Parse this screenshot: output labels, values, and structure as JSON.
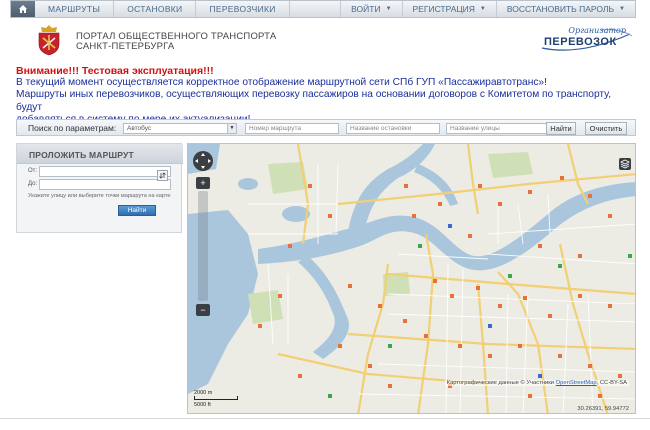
{
  "nav": {
    "items": [
      "Маршруты",
      "Остановки",
      "Перевозчики"
    ],
    "right": [
      {
        "label": "Войти"
      },
      {
        "label": "Регистрация"
      },
      {
        "label": "Восстановить пароль"
      }
    ],
    "home_icon": "home-icon"
  },
  "header": {
    "title_line1": "ПОРТАЛ ОБЩЕСТВЕННОГО ТРАНСПОРТА",
    "title_line2": "САНКТ-ПЕТЕРБУРГА",
    "org_top": "Организатор",
    "org_main": "ПЕРЕВОЗОК"
  },
  "notice": {
    "warning": "Внимание!!! Тестовая эксплуатация!!!",
    "line1": "В текущий момент осуществляется корректное отображение маршрутной сети СПб ГУП «Пассажиравтотранс»!",
    "line2": "Маршруты иных перевозчиков, осуществляющих перевозку пассажиров на основании договоров с Комитетом по транспорту, будут",
    "line3": "добавляться в систему по мере их актуализации!"
  },
  "search": {
    "label": "Поиск по параметрам:",
    "transport_value": "Автобус",
    "route_placeholder": "Номер маршрута",
    "stop_placeholder": "Название остановки",
    "street_placeholder": "Название улицы",
    "find_label": "Найти",
    "clear_label": "Очистить"
  },
  "route": {
    "title": "ПРОЛОЖИТЬ МАРШРУТ",
    "from_label": "От:",
    "to_label": "До:",
    "hint": "Укажите улицу или выберите точки маршрута на карте",
    "find_label": "Найти"
  },
  "map": {
    "attribution_prefix": "Картографические данные © Участники",
    "attribution_link": "OpenStreetMap",
    "attribution_suffix": ", CC-BY-SA",
    "coords": "30.26391, 59.94772",
    "scale_top": "2000 m",
    "scale_bottom": "5000 ft",
    "colors": {
      "water": "#a9c6dc",
      "land": "#ecebe4",
      "road_major": "#f3cf73",
      "road_minor": "#ffffff",
      "park": "#cfe0b6"
    }
  }
}
